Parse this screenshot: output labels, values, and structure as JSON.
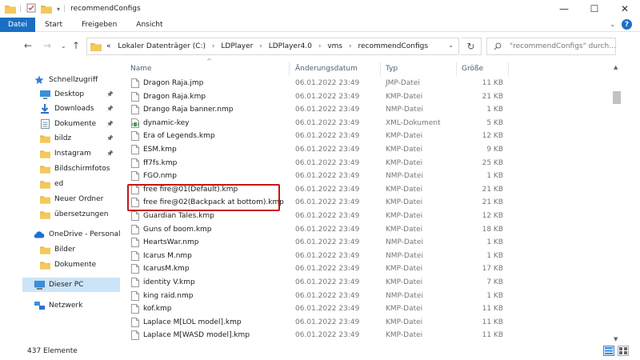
{
  "window": {
    "title": "recommendConfigs",
    "controls": [
      "—",
      "☐",
      "✕"
    ]
  },
  "ribbon": {
    "tabs": [
      "Datei",
      "Start",
      "Freigeben",
      "Ansicht"
    ],
    "active_tab": "Datei"
  },
  "address_bar": {
    "crumbs": [
      "Lokaler Datenträger (C:)",
      "LDPlayer",
      "LDPlayer4.0",
      "vms",
      "recommendConfigs"
    ],
    "overflow": "«",
    "search_placeholder": "\"recommendConfigs\" durch..."
  },
  "nav_pane": {
    "items": [
      {
        "label": "Schnellzugriff",
        "icon": "star-icon",
        "pinned": false,
        "indent": 0,
        "selected": false
      },
      {
        "label": "Desktop",
        "icon": "desktop-icon",
        "pinned": true,
        "indent": 1,
        "selected": false
      },
      {
        "label": "Downloads",
        "icon": "download-icon",
        "pinned": true,
        "indent": 1,
        "selected": false
      },
      {
        "label": "Dokumente",
        "icon": "documents-icon",
        "pinned": true,
        "indent": 1,
        "selected": false
      },
      {
        "label": "bildz",
        "icon": "folder-icon",
        "pinned": true,
        "indent": 1,
        "selected": false
      },
      {
        "label": "Instagram",
        "icon": "folder-icon",
        "pinned": true,
        "indent": 1,
        "selected": false
      },
      {
        "label": "Bildschirmfotos",
        "icon": "folder-icon",
        "pinned": false,
        "indent": 1,
        "selected": false
      },
      {
        "label": "ed",
        "icon": "folder-icon",
        "pinned": false,
        "indent": 1,
        "selected": false
      },
      {
        "label": "Neuer Ordner",
        "icon": "folder-icon",
        "pinned": false,
        "indent": 1,
        "selected": false
      },
      {
        "label": "übersetzungen",
        "icon": "folder-icon",
        "pinned": false,
        "indent": 1,
        "selected": false
      },
      {
        "label": "OneDrive - Personal",
        "icon": "cloud-icon",
        "pinned": false,
        "indent": 0,
        "selected": false
      },
      {
        "label": "Bilder",
        "icon": "folder-icon",
        "pinned": false,
        "indent": 1,
        "selected": false
      },
      {
        "label": "Dokumente",
        "icon": "folder-icon",
        "pinned": false,
        "indent": 1,
        "selected": false
      },
      {
        "label": "Dieser PC",
        "icon": "computer-icon",
        "pinned": false,
        "indent": 0,
        "selected": true
      },
      {
        "label": "Netzwerk",
        "icon": "network-icon",
        "pinned": false,
        "indent": 0,
        "selected": false
      }
    ]
  },
  "columns": {
    "name": "Name",
    "date": "Änderungsdatum",
    "type": "Typ",
    "size": "Größe"
  },
  "files": [
    {
      "name": "Dragon Raja.jmp",
      "date": "06.01.2022 23:49",
      "type": "JMP-Datei",
      "size": "11 KB",
      "icon": "file-icon"
    },
    {
      "name": "Dragon Raja.kmp",
      "date": "06.01.2022 23:49",
      "type": "KMP-Datei",
      "size": "21 KB",
      "icon": "file-icon"
    },
    {
      "name": "Drango Raja banner.nmp",
      "date": "06.01.2022 23:49",
      "type": "NMP-Datei",
      "size": "1 KB",
      "icon": "file-icon"
    },
    {
      "name": "dynamic-key",
      "date": "06.01.2022 23:49",
      "type": "XML-Dokument",
      "size": "5 KB",
      "icon": "xml-file-icon"
    },
    {
      "name": "Era of Legends.kmp",
      "date": "06.01.2022 23:49",
      "type": "KMP-Datei",
      "size": "12 KB",
      "icon": "file-icon"
    },
    {
      "name": "ESM.kmp",
      "date": "06.01.2022 23:49",
      "type": "KMP-Datei",
      "size": "9 KB",
      "icon": "file-icon"
    },
    {
      "name": "ff7fs.kmp",
      "date": "06.01.2022 23:49",
      "type": "KMP-Datei",
      "size": "25 KB",
      "icon": "file-icon"
    },
    {
      "name": "FGO.nmp",
      "date": "06.01.2022 23:49",
      "type": "NMP-Datei",
      "size": "1 KB",
      "icon": "file-icon"
    },
    {
      "name": "free fire@01(Default).kmp",
      "date": "06.01.2022 23:49",
      "type": "KMP-Datei",
      "size": "21 KB",
      "icon": "file-icon"
    },
    {
      "name": "free fire@02(Backpack at bottom).kmp",
      "date": "06.01.2022 23:49",
      "type": "KMP-Datei",
      "size": "21 KB",
      "icon": "file-icon"
    },
    {
      "name": "Guardian Tales.kmp",
      "date": "06.01.2022 23:49",
      "type": "KMP-Datei",
      "size": "12 KB",
      "icon": "file-icon"
    },
    {
      "name": "Guns of boom.kmp",
      "date": "06.01.2022 23:49",
      "type": "KMP-Datei",
      "size": "18 KB",
      "icon": "file-icon"
    },
    {
      "name": "HeartsWar.nmp",
      "date": "06.01.2022 23:49",
      "type": "NMP-Datei",
      "size": "1 KB",
      "icon": "file-icon"
    },
    {
      "name": "Icarus M.nmp",
      "date": "06.01.2022 23:49",
      "type": "NMP-Datei",
      "size": "1 KB",
      "icon": "file-icon"
    },
    {
      "name": "IcarusM.kmp",
      "date": "06.01.2022 23:49",
      "type": "KMP-Datei",
      "size": "17 KB",
      "icon": "file-icon"
    },
    {
      "name": "identity V.kmp",
      "date": "06.01.2022 23:49",
      "type": "KMP-Datei",
      "size": "7 KB",
      "icon": "file-icon"
    },
    {
      "name": "king raid.nmp",
      "date": "06.01.2022 23:49",
      "type": "NMP-Datei",
      "size": "1 KB",
      "icon": "file-icon"
    },
    {
      "name": "kof.kmp",
      "date": "06.01.2022 23:49",
      "type": "KMP-Datei",
      "size": "11 KB",
      "icon": "file-icon"
    },
    {
      "name": "Laplace M[LOL model].kmp",
      "date": "06.01.2022 23:49",
      "type": "KMP-Datei",
      "size": "11 KB",
      "icon": "file-icon"
    },
    {
      "name": "Laplace M[WASD model].kmp",
      "date": "06.01.2022 23:49",
      "type": "KMP-Datei",
      "size": "11 KB",
      "icon": "file-icon"
    }
  ],
  "highlighted_files": [
    "free fire@01(Default).kmp",
    "free fire@02(Backpack at bottom).kmp"
  ],
  "status_bar": {
    "item_count": "437 Elemente"
  },
  "colors": {
    "accent": "#1a6fc4",
    "selection": "#cce4f7",
    "highlight_box": "#c81414",
    "folder": "#e8b94a"
  }
}
